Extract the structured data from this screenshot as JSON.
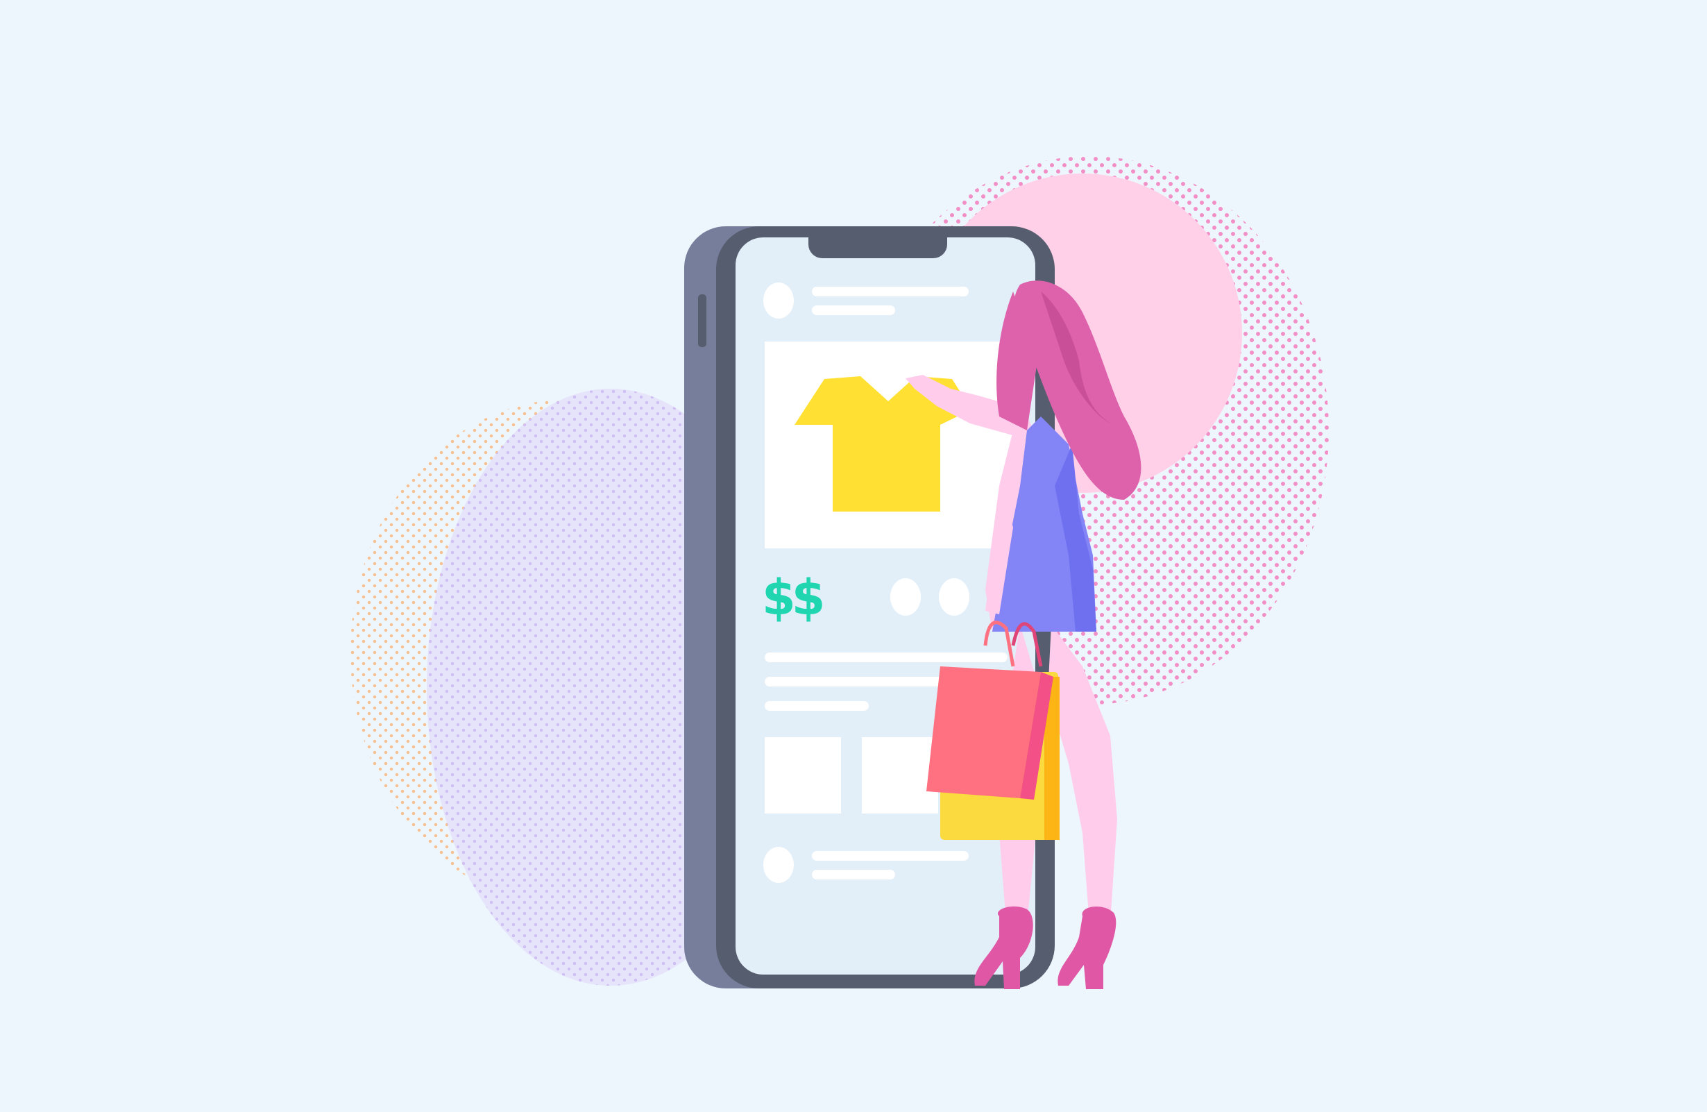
{
  "scene": {
    "description_free": true,
    "colors": {
      "background": "#eef6fd",
      "phone_frame": "#565d6f",
      "phone_side": "#767e9b",
      "screen": "#e2eef8",
      "shirt": "#ffe033",
      "price_text": "#1fd6b1",
      "hair": "#de62ab",
      "dress": "#8384f5",
      "skin": "#ffcdeb",
      "bag_red": "#ff7180",
      "bag_yellow": "#fbda3f",
      "shoes": "#e057a6"
    }
  },
  "product_card": {
    "price": "$$"
  },
  "icons": {
    "phone": "phone-icon",
    "shirt": "tshirt-icon",
    "bags": "shopping-bag-icon"
  }
}
